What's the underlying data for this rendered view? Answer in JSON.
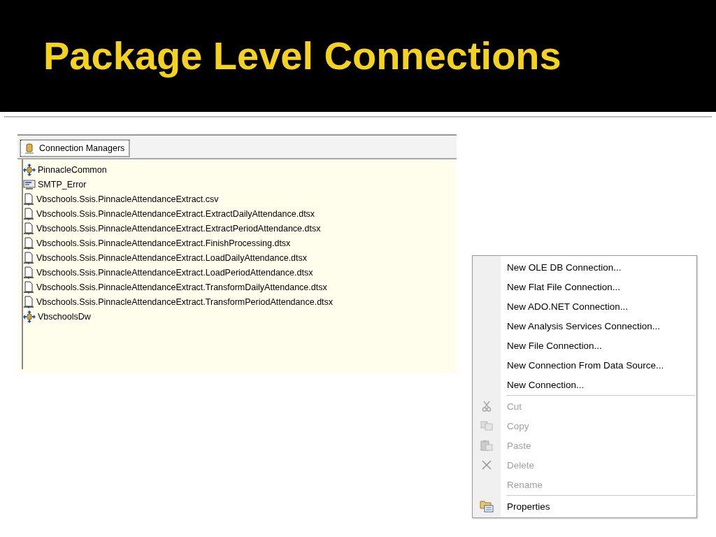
{
  "title": "Package Level Connections",
  "panel": {
    "tab": {
      "label": "Connection Managers",
      "selected": true
    },
    "connections": [
      {
        "name": "PinnacleCommon",
        "kind": "database"
      },
      {
        "name": "SMTP_Error",
        "kind": "smtp"
      },
      {
        "name": "Vbschools.Ssis.PinnacleAttendanceExtract.csv",
        "kind": "file"
      },
      {
        "name": "Vbschools.Ssis.PinnacleAttendanceExtract.ExtractDailyAttendance.dtsx",
        "kind": "file"
      },
      {
        "name": "Vbschools.Ssis.PinnacleAttendanceExtract.ExtractPeriodAttendance.dtsx",
        "kind": "file"
      },
      {
        "name": "Vbschools.Ssis.PinnacleAttendanceExtract.FinishProcessing.dtsx",
        "kind": "file"
      },
      {
        "name": "Vbschools.Ssis.PinnacleAttendanceExtract.LoadDailyAttendance.dtsx",
        "kind": "file"
      },
      {
        "name": "Vbschools.Ssis.PinnacleAttendanceExtract.LoadPeriodAttendance.dtsx",
        "kind": "file"
      },
      {
        "name": "Vbschools.Ssis.PinnacleAttendanceExtract.TransformDailyAttendance.dtsx",
        "kind": "file"
      },
      {
        "name": "Vbschools.Ssis.PinnacleAttendanceExtract.TransformPeriodAttendance.dtsx",
        "kind": "file"
      },
      {
        "name": "VbschoolsDw",
        "kind": "database"
      }
    ]
  },
  "context_menu": {
    "sections": [
      [
        {
          "label": "New OLE DB Connection...",
          "disabled": false,
          "kind": "plain"
        },
        {
          "label": "New Flat File Connection...",
          "disabled": false,
          "kind": "plain"
        },
        {
          "label": "New ADO.NET Connection...",
          "disabled": false,
          "kind": "plain"
        },
        {
          "label": "New Analysis Services Connection...",
          "disabled": false,
          "kind": "plain"
        },
        {
          "label": "New File Connection...",
          "disabled": false,
          "kind": "plain"
        },
        {
          "label": "New Connection From Data Source...",
          "disabled": false,
          "kind": "plain"
        },
        {
          "label": "New Connection...",
          "disabled": false,
          "kind": "plain"
        }
      ],
      [
        {
          "label": "Cut",
          "disabled": true,
          "kind": "cut"
        },
        {
          "label": "Copy",
          "disabled": true,
          "kind": "copy"
        },
        {
          "label": "Paste",
          "disabled": true,
          "kind": "paste"
        },
        {
          "label": "Delete",
          "disabled": true,
          "kind": "delete"
        },
        {
          "label": "Rename",
          "disabled": true,
          "kind": "plain"
        }
      ],
      [
        {
          "label": "Properties",
          "disabled": false,
          "kind": "properties"
        }
      ]
    ]
  }
}
